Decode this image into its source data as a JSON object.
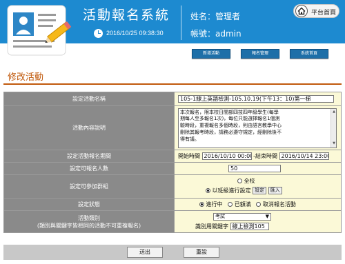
{
  "header": {
    "app_title": "活動報名系統",
    "datetime": "2016/10/25 09:38:30",
    "user_name": "姓名：管理者",
    "user_account": "帳號：admin",
    "home_button": "平台首頁",
    "brand_color": "#1d8ad0"
  },
  "nav": {
    "items": [
      {
        "label": "新增活動"
      },
      {
        "label": "報名管理"
      },
      {
        "label": "系統首頁"
      }
    ],
    "color": "#1e6fa8"
  },
  "page": {
    "title": "修改活動",
    "accent_color": "#c0580a"
  },
  "form": {
    "rows": {
      "name": {
        "label": "設定活動名稱",
        "value": "105-1線上英語檢測-105.10.19(下午13：10)第一梯"
      },
      "desc": {
        "label": "活動內容說明",
        "lines": [
          "本次報名，限本校日間部四技四年級學生(每學",
          "期每人至多報名1次)，每位只能選擇報名1個測",
          "驗時段，重複報名多個時段，則由語言教學中心",
          "刪除其報考時段，請務必遵守規定，經刪除後不",
          "得有議。"
        ]
      },
      "period": {
        "label": "設定活動報名期間",
        "start_label": "開始時間",
        "start_value": "2016/10/10 00:00",
        "end_label": "-結束時間",
        "end_value": "2016/10/14 23:00"
      },
      "quota": {
        "label": "設定可報名人數",
        "value": "50"
      },
      "group": {
        "label": "設定可參加群組",
        "option_all": "全校",
        "option_class": "以班級進行設定",
        "btn_set": "設定",
        "btn_import": "匯入",
        "selected": "option_class"
      },
      "status": {
        "label": "設定狀態",
        "options": [
          "進行中",
          "已額滿",
          "取消報名活動"
        ],
        "selected": "進行中"
      },
      "category": {
        "label_line1": "活動類別",
        "label_line2": "(類別與關鍵字皆相同的活動不可重複報名)",
        "select_value": "考試",
        "keyword_label": "識別用關鍵字",
        "keyword_value": "線上檢測105"
      }
    }
  },
  "actions": {
    "submit": "送出",
    "reset": "重設"
  }
}
